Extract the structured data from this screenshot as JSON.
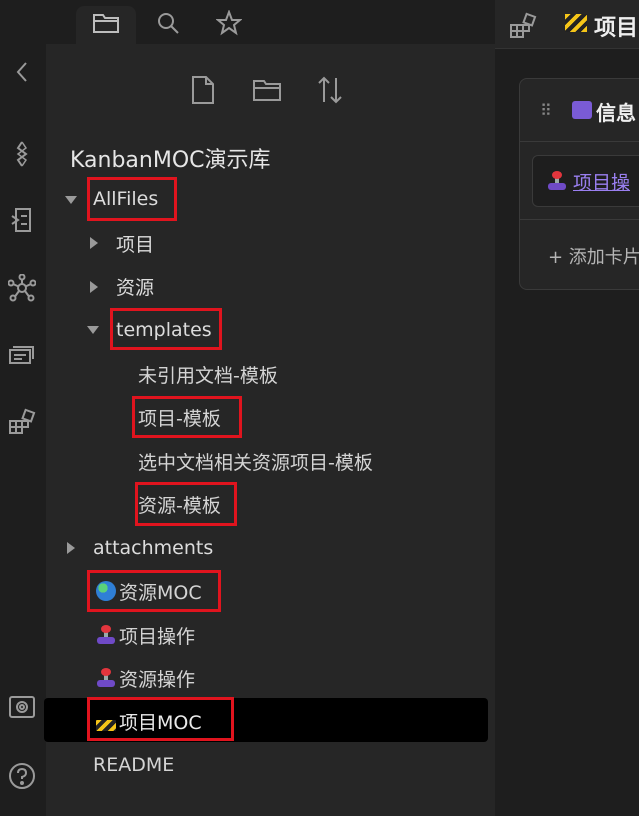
{
  "tabs": {
    "files_icon": "folder-icon",
    "search_icon": "search-icon",
    "bookmarks_icon": "star-icon"
  },
  "ribbon": {
    "icons": [
      "collapse-icon",
      "vault-icon",
      "note-switch-icon",
      "graph-icon",
      "cards-icon",
      "blocks-icon",
      "vault-settings-icon",
      "help-icon"
    ]
  },
  "toolbar": {
    "new_note_icon": "new-note-icon",
    "new_folder_icon": "new-folder-icon",
    "sort_icon": "sort-icon"
  },
  "vault_title": "KanbanMOC演示库",
  "tree": {
    "allfiles": "AllFiles",
    "xiangmu": "项目",
    "ziyuan": "资源",
    "templates": "templates",
    "t1": "未引用文档-模板",
    "t2": "项目-模板",
    "t3": "选中文档相关资源项目-模板",
    "t4": "资源-模板",
    "attachments": "attachments",
    "moc_resource": "资源MOC",
    "op_project": "项目操作",
    "op_resource": "资源操作",
    "moc_project": "项目MOC",
    "readme": "README"
  },
  "right": {
    "tab_title": "项目",
    "card_title": "信息",
    "card_link": "项目操",
    "add_card": "+ 添加卡片"
  },
  "colors": {
    "highlight": "#e0141e",
    "accent_link": "#9a7ff0"
  }
}
